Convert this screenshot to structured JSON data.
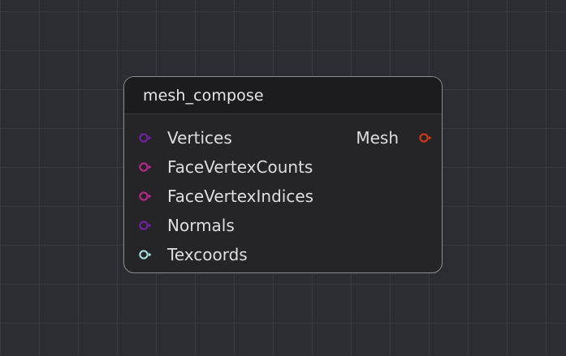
{
  "node": {
    "title": "mesh_compose",
    "inputs": [
      {
        "label": "Vertices",
        "color": "#7a1fa8",
        "icon": "port-circle-arrow-icon"
      },
      {
        "label": "FaceVertexCounts",
        "color": "#c2268f",
        "icon": "port-circle-arrow-icon"
      },
      {
        "label": "FaceVertexIndices",
        "color": "#c2268f",
        "icon": "port-circle-arrow-icon"
      },
      {
        "label": "Normals",
        "color": "#7a1fa8",
        "icon": "port-circle-arrow-icon"
      },
      {
        "label": "Texcoords",
        "color": "#a6e3e3",
        "icon": "port-circle-arrow-icon"
      }
    ],
    "outputs": [
      {
        "label": "Mesh",
        "color": "#d83a14",
        "icon": "port-circle-arrow-icon"
      }
    ]
  }
}
